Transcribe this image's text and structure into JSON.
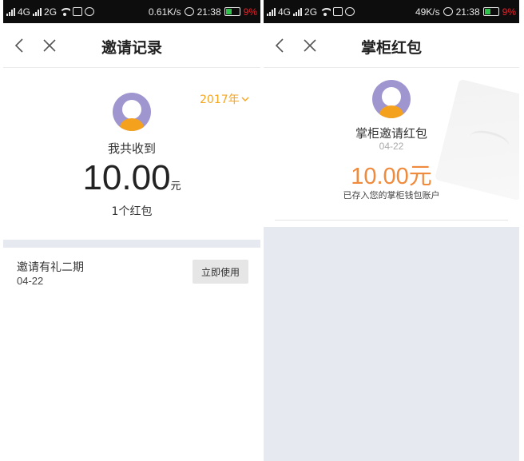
{
  "status_left": {
    "network_left": "4G",
    "network_right": "2G",
    "speed": "0.61K/s",
    "time": "21:38",
    "battery": "9%"
  },
  "status_right": {
    "network_left": "4G",
    "network_right": "2G",
    "speed": "49K/s",
    "time": "21:38",
    "battery": "9%"
  },
  "invite_records": {
    "title": "邀请记录",
    "year": "2017年",
    "summary_label": "我共收到",
    "amount": "10.00",
    "amount_unit": "元",
    "count": "1个红包",
    "records": [
      {
        "name": "邀请有礼二期",
        "date": "04-22",
        "action": "立即使用"
      }
    ]
  },
  "red_packet": {
    "title": "掌柜红包",
    "name": "掌柜邀请红包",
    "date": "04-22",
    "amount": "10.00元",
    "note": "已存入您的掌柜钱包账户"
  },
  "colors": {
    "accent_orange": "#f5a623",
    "amount_orange": "#f08a3c",
    "avatar_purple": "#9f96cf",
    "band_grey": "#e6e9f0",
    "battery_red": "#e0262c"
  }
}
